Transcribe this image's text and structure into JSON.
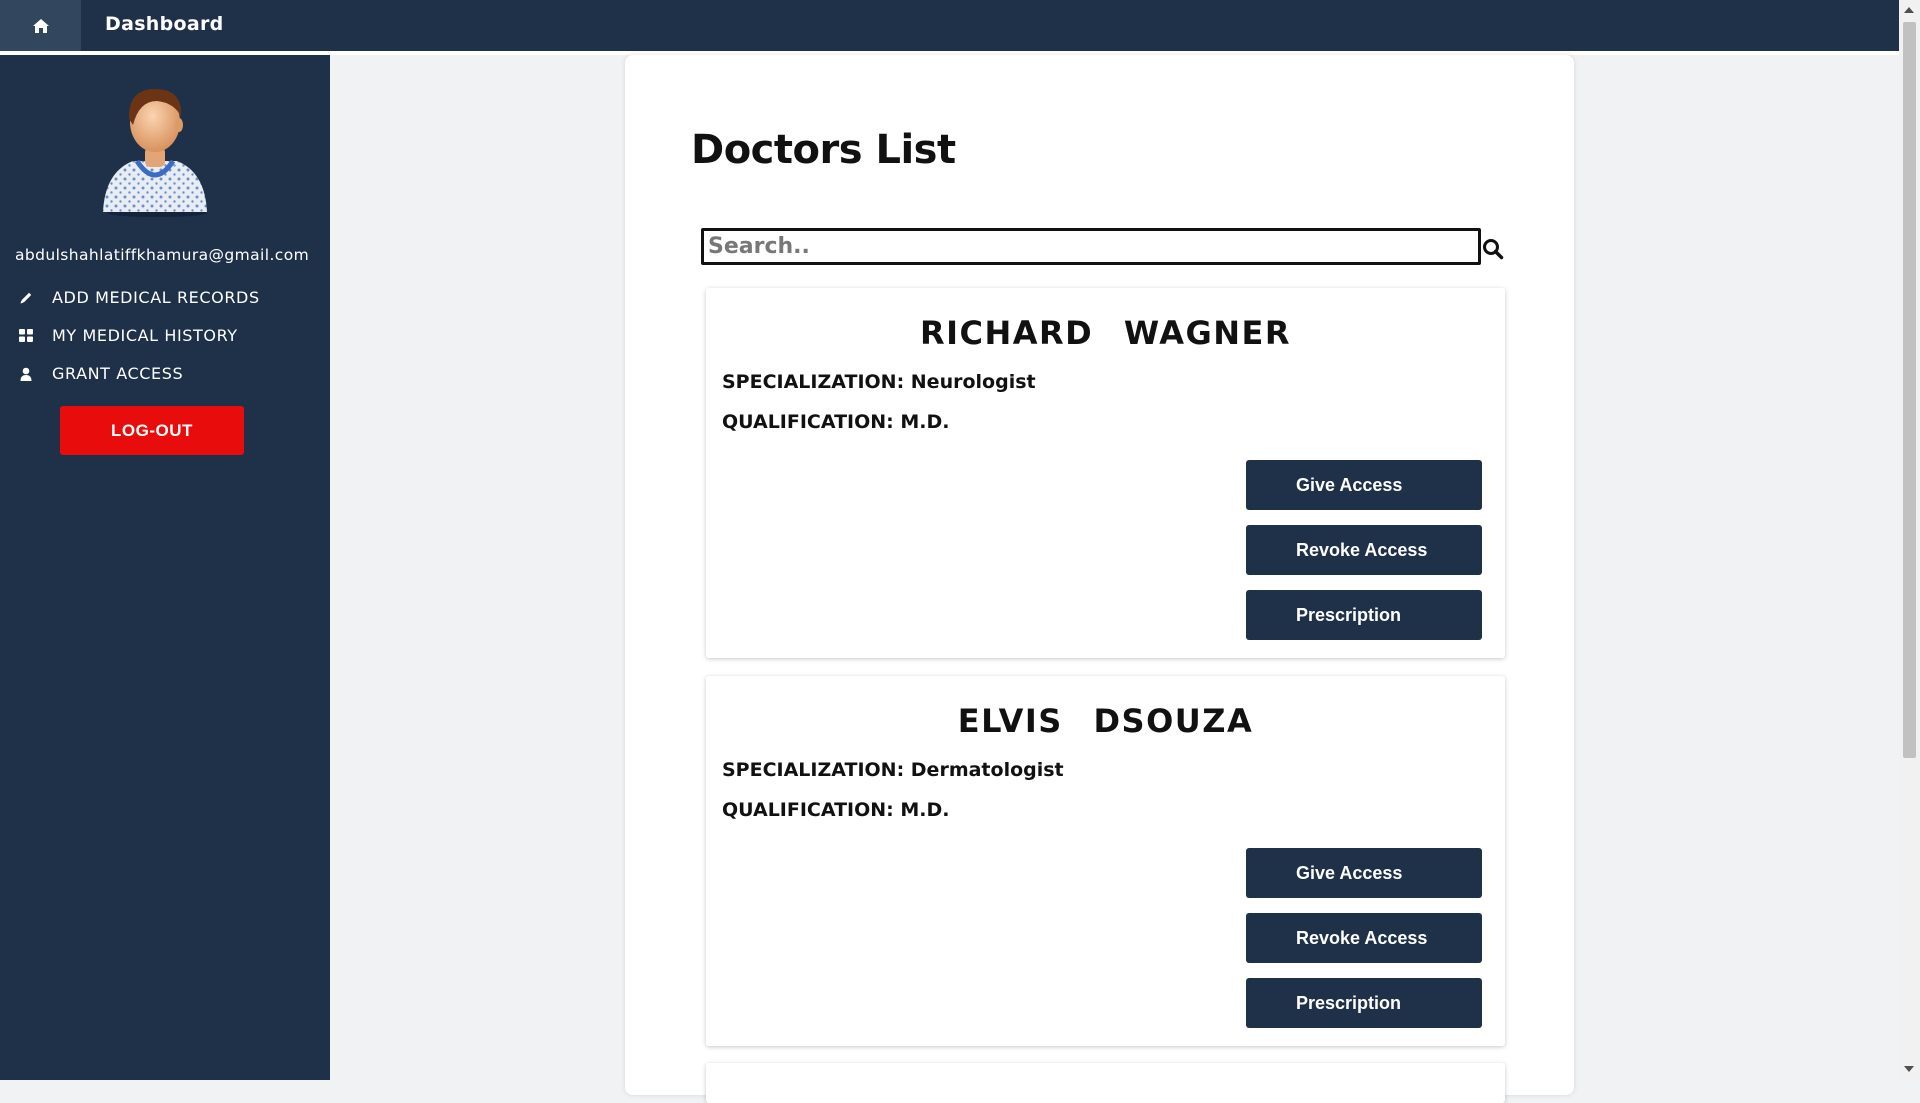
{
  "header": {
    "title": "Dashboard",
    "home_icon": "home-icon"
  },
  "sidebar": {
    "email": "abdulshahlatiffkhamura@gmail.com",
    "items": [
      {
        "label": "ADD MEDICAL RECORDS",
        "icon": "pencil-icon"
      },
      {
        "label": "MY MEDICAL HISTORY",
        "icon": "grid-icon"
      },
      {
        "label": "GRANT ACCESS",
        "icon": "user-icon"
      }
    ],
    "logout_label": "LOG-OUT"
  },
  "main": {
    "title": "Doctors List",
    "search_placeholder": "Search..",
    "doctors": [
      {
        "name": "RICHARD   WAGNER",
        "specialization": "SPECIALIZATION: Neurologist",
        "qualification": "QUALIFICATION: M.D."
      },
      {
        "name": "ELVIS   DSOUZA",
        "specialization": "SPECIALIZATION: Dermatologist",
        "qualification": "QUALIFICATION: M.D."
      }
    ],
    "buttons": {
      "give": "Give Access",
      "revoke": "Revoke Access",
      "prescription": "Prescription"
    }
  },
  "colors": {
    "navy": "#1f3149",
    "logout_red": "#e80c0c",
    "background": "#f1f2f4"
  }
}
